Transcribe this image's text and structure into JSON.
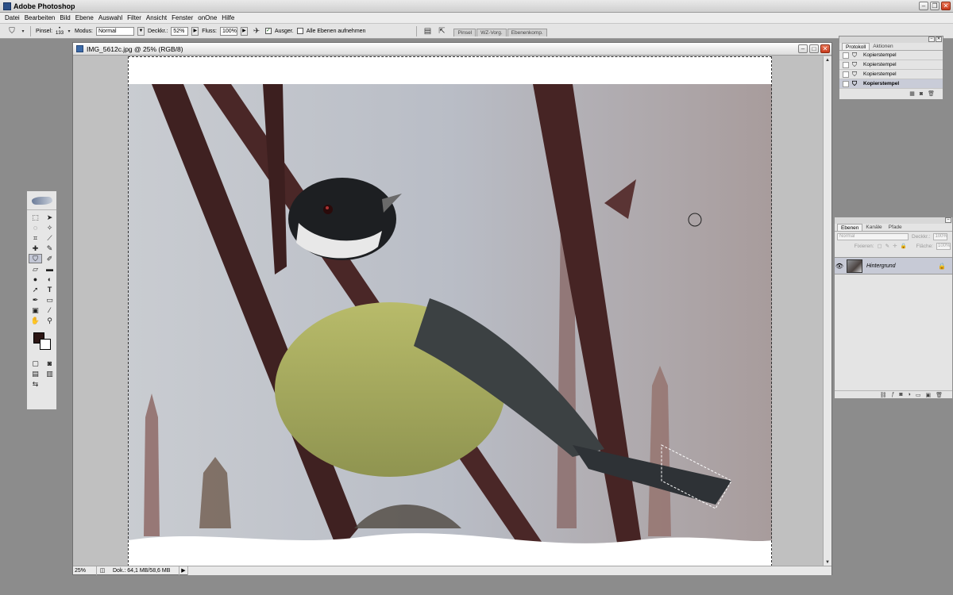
{
  "app": {
    "title": "Adobe Photoshop"
  },
  "menu": [
    "Datei",
    "Bearbeiten",
    "Bild",
    "Ebene",
    "Auswahl",
    "Filter",
    "Ansicht",
    "Fenster",
    "onOne",
    "Hilfe"
  ],
  "options": {
    "brush_label": "Pinsel:",
    "brush_size": "133",
    "mode_label": "Modus:",
    "mode_value": "Normal",
    "opacity_label": "Deckkr.:",
    "opacity_value": "52%",
    "flow_label": "Fluss:",
    "flow_value": "100%",
    "aligned_label": "Ausger.",
    "aligned_checked": "✓",
    "all_layers_label": "Alle Ebenen aufnehmen",
    "palette_well": [
      "Pinsel",
      "WZ-Vorg.",
      "Ebenenkomp."
    ]
  },
  "document": {
    "title": "IMG_5612c.jpg @ 25% (RGB/8)",
    "zoom": "25%",
    "doc_info": "Dok.: 64,1 MB/58,6 MB"
  },
  "history": {
    "tabs": [
      "Protokoll",
      "Aktionen"
    ],
    "items": [
      "Kopierstempel",
      "Kopierstempel",
      "Kopierstempel",
      "Kopierstempel"
    ]
  },
  "layers": {
    "tabs": [
      "Ebenen",
      "Kanäle",
      "Pfade"
    ],
    "blend_mode": "Normal",
    "opacity_label": "Deckkr.:",
    "opacity_value": "100%",
    "lock_label": "Fixieren:",
    "fill_label": "Fläche:",
    "fill_value": "100%",
    "layer_name": "Hintergrund"
  },
  "colors": {
    "foreground": "#2c1614",
    "background": "#ffffff"
  }
}
